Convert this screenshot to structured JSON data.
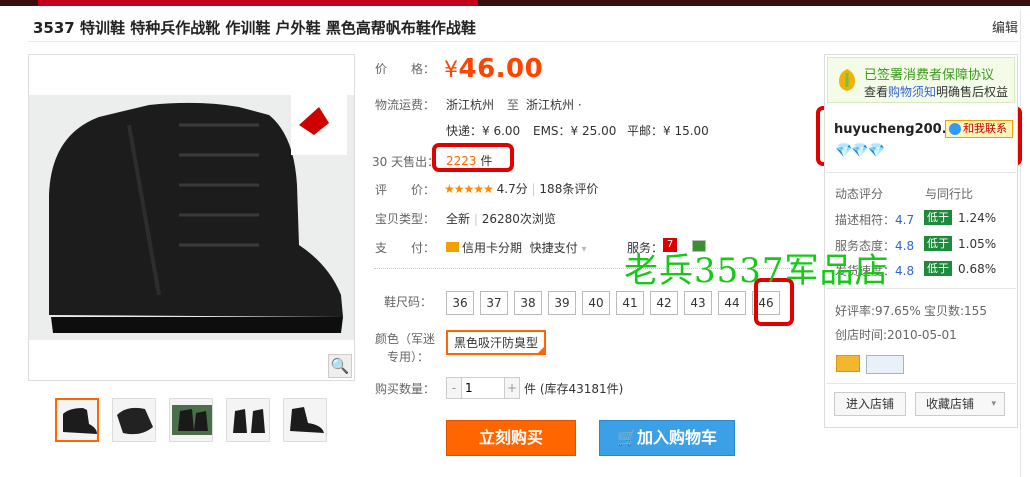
{
  "title": "3537 特训鞋 特种兵作战靴 作训鞋 户外鞋 黑色高帮帆布鞋作战鞋",
  "edit_label": "编辑",
  "price": {
    "label": "价　　格：",
    "currency": "¥",
    "value": "46.00"
  },
  "shipping": {
    "label": "物流运费：",
    "from": "浙江杭州",
    "to_label": "至",
    "to": "浙江杭州 ·",
    "express": "快递：¥ 6.00",
    "ems": "EMS：¥ 25.00",
    "post": "平邮：¥ 15.00"
  },
  "sales": {
    "label": "30 天售出：",
    "count": "2223",
    "unit": "件"
  },
  "rating": {
    "label": "评　　价：",
    "stars": "★★★★★",
    "score": "4.7分",
    "reviews": "188条评价"
  },
  "item_type": {
    "label": "宝贝类型：",
    "value": "全新",
    "views": "26280次浏览"
  },
  "payment": {
    "label": "支　　付：",
    "credit": "信用卡分期",
    "quick": "快捷支付",
    "service_label": "服务："
  },
  "sizes": {
    "label": "鞋尺码：",
    "options": [
      "36",
      "37",
      "38",
      "39",
      "40",
      "41",
      "42",
      "43",
      "44",
      "46"
    ]
  },
  "color": {
    "label_line1": "颜色（军迷",
    "label_line2": "专用）：",
    "option": "黑色吸汗防臭型"
  },
  "quantity": {
    "label": "购买数量：",
    "value": "1",
    "stock": "件 (库存43181件)",
    "minus": "-",
    "plus": "+"
  },
  "buttons": {
    "buy_now": "立刻购买",
    "add_cart": "加入购物车"
  },
  "watermark": "老兵3537军品店",
  "guarantee": {
    "line1": "已签署消费者保障协议",
    "line2_prefix": "查看",
    "line2_link": "购物须知",
    "line2_suffix": "明确售后权益"
  },
  "seller": {
    "name": "huyucheng200...",
    "contact": "和我联系",
    "diamonds": "💎💎💎"
  },
  "dynamic": {
    "header_left": "动态评分",
    "header_right": "与同行比",
    "rows": [
      {
        "label": "描述相符：",
        "score": "4.7",
        "compare": "低于",
        "pct": "1.24%"
      },
      {
        "label": "服务态度：",
        "score": "4.8",
        "compare": "低于",
        "pct": "1.05%"
      },
      {
        "label": "发货速度：",
        "score": "4.8",
        "compare": "低于",
        "pct": "0.68%"
      }
    ]
  },
  "shop_stats": {
    "good_rate": "好评率:97.65%",
    "item_count": "宝贝数:155",
    "created": "创店时间:2010-05-01"
  },
  "shop_buttons": {
    "enter": "进入店铺",
    "favorite": "收藏店铺"
  },
  "colors": {
    "accent": "#ff6600",
    "price": "#ff4400",
    "cart": "#3ca0e6",
    "highlight": "#e10000",
    "watermark": "#18c818"
  }
}
